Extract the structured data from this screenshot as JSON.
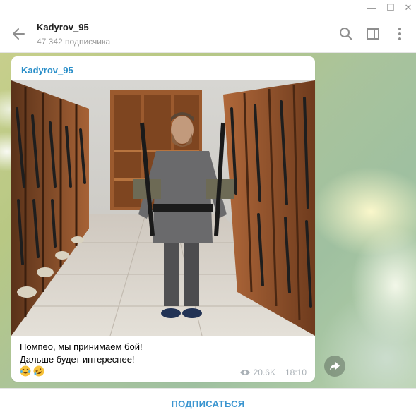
{
  "window": {
    "minimize_glyph": "—",
    "maximize_glyph": "☐",
    "close_glyph": "✕"
  },
  "header": {
    "title": "Kadyrov_95",
    "subtitle": "47 342 подписчика",
    "icons": [
      "back-arrow-icon",
      "search-icon",
      "sidebar-toggle-icon",
      "more-vertical-icon"
    ]
  },
  "post": {
    "author": "Kadyrov_95",
    "caption_line1": "Помпео, мы принимаем бой!",
    "caption_line2": "Дальше будет интереснее!",
    "emojis": [
      "😂",
      "🤣"
    ],
    "views": "20.6K",
    "time": "18:10"
  },
  "footer": {
    "subscribe_label": "ПОДПИСАТЬСЯ"
  },
  "colors": {
    "accent": "#3a95d0",
    "author": "#2b8fc9"
  }
}
